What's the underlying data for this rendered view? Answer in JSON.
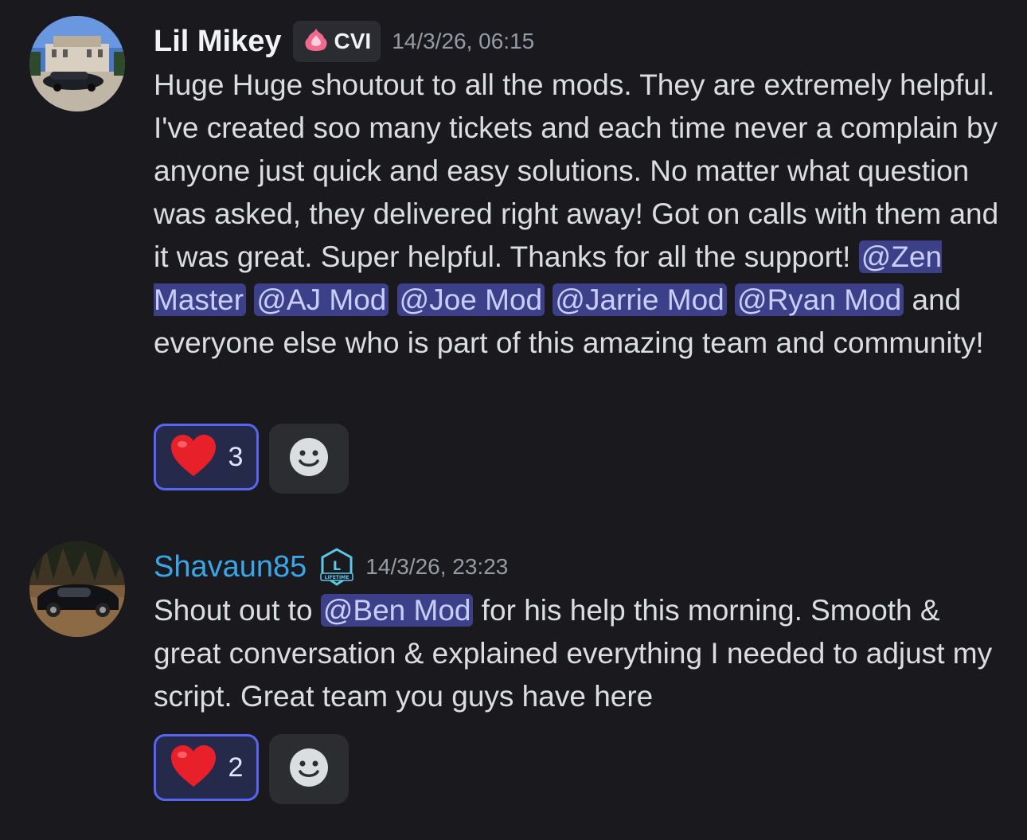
{
  "messages": [
    {
      "username": "Lil Mikey",
      "tag": "CVI",
      "tag_icon": "pink-flame-icon",
      "timestamp": "14/3/26, 06:15",
      "text_before": "Huge Huge shoutout to all the mods. They are extremely helpful. I've created soo many tickets and each time never a complain by anyone just quick and easy solutions. No matter what question was asked, they delivered right away! Got on calls with them and it was great. Super helpful. Thanks for all the support! ",
      "mentions": [
        "@Zen Master",
        "@AJ Mod",
        "@Joe Mod",
        "@Jarrie Mod",
        "@Ryan Mod"
      ],
      "text_after": " and everyone else who is part of this amazing team and community!",
      "reaction_emoji": "❤️",
      "reaction_count": "3"
    },
    {
      "username": "Shavaun85",
      "badge_icon": "lifetime-badge-icon",
      "badge_text": "LIFETIME",
      "timestamp": "14/3/26, 23:23",
      "text_before": "Shout out to ",
      "mention": "@Ben Mod",
      "text_after": " for his help this morning. Smooth & great conversation & explained everything I needed to adjust my script. Great team you guys have here",
      "reaction_emoji": "❤️",
      "reaction_count": "2"
    }
  ],
  "colors": {
    "background": "#1a1a1e",
    "mention_bg": "#3b4089",
    "reaction_border": "#5865f2",
    "username_alt": "#3aa6e8"
  }
}
